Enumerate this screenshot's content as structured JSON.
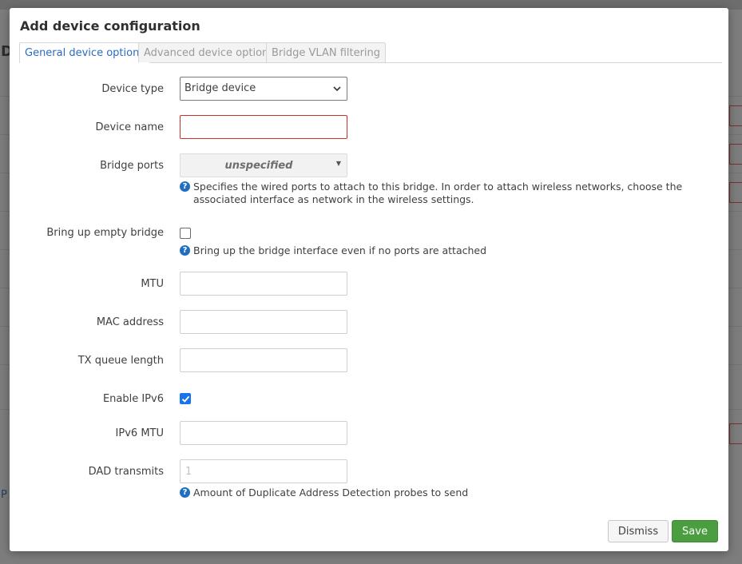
{
  "background": {
    "letter": "D",
    "link": "P"
  },
  "modal": {
    "title": "Add device configuration",
    "tabs": [
      {
        "label": "General device options",
        "active": true
      },
      {
        "label": "Advanced device options",
        "active": false
      },
      {
        "label": "Bridge VLAN filtering",
        "active": false
      }
    ]
  },
  "form": {
    "device_type": {
      "label": "Device type",
      "value": "Bridge device"
    },
    "device_name": {
      "label": "Device name",
      "value": ""
    },
    "bridge_ports": {
      "label": "Bridge ports",
      "value": "unspecified",
      "help": "Specifies the wired ports to attach to this bridge. In order to attach wireless networks, choose the associated interface as network in the wireless settings."
    },
    "bring_up_empty_bridge": {
      "label": "Bring up empty bridge",
      "checked": false,
      "help": "Bring up the bridge interface even if no ports are attached"
    },
    "mtu": {
      "label": "MTU",
      "value": ""
    },
    "mac_address": {
      "label": "MAC address",
      "value": ""
    },
    "tx_queue_length": {
      "label": "TX queue length",
      "value": ""
    },
    "enable_ipv6": {
      "label": "Enable IPv6",
      "checked": true
    },
    "ipv6_mtu": {
      "label": "IPv6 MTU",
      "value": ""
    },
    "dad_transmits": {
      "label": "DAD transmits",
      "value": "",
      "placeholder": "1",
      "help": "Amount of Duplicate Address Detection probes to send"
    },
    "help_icon_glyph": "?"
  },
  "actions": {
    "dismiss": "Dismiss",
    "save": "Save"
  },
  "colors": {
    "primary": "#1a73e8",
    "save": "#4a9e3f",
    "error": "#c9302c",
    "tab_active": "#2a6bbf"
  }
}
